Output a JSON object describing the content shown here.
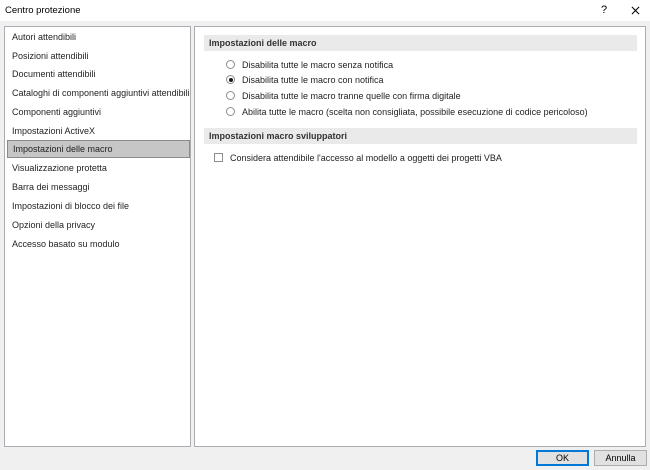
{
  "window": {
    "title": "Centro protezione",
    "help_label": "?"
  },
  "sidebar": {
    "items": [
      {
        "label": "Autori attendibili"
      },
      {
        "label": "Posizioni attendibili"
      },
      {
        "label": "Documenti attendibili"
      },
      {
        "label": "Cataloghi di componenti aggiuntivi attendibili"
      },
      {
        "label": "Componenti aggiuntivi"
      },
      {
        "label": "Impostazioni ActiveX"
      },
      {
        "label": "Impostazioni delle macro",
        "selected": true
      },
      {
        "label": "Visualizzazione protetta"
      },
      {
        "label": "Barra dei messaggi"
      },
      {
        "label": "Impostazioni di blocco dei file"
      },
      {
        "label": "Opzioni della privacy"
      },
      {
        "label": "Accesso basato su modulo"
      }
    ]
  },
  "macro_settings": {
    "header": "Impostazioni delle macro",
    "options": [
      {
        "label": "Disabilita tutte le macro senza notifica",
        "selected": false
      },
      {
        "label": "Disabilita tutte le macro con notifica",
        "selected": true
      },
      {
        "label": "Disabilita tutte le macro tranne quelle con firma digitale",
        "selected": false
      },
      {
        "label": "Abilita tutte le macro (scelta non consigliata, possibile esecuzione di codice pericoloso)",
        "selected": false
      }
    ]
  },
  "developer_settings": {
    "header": "Impostazioni macro sviluppatori",
    "checkbox_label": "Considera attendibile l'accesso al modello a oggetti dei progetti VBA",
    "checked": false
  },
  "footer": {
    "ok_label": "OK",
    "cancel_label": "Annulla"
  },
  "colors": {
    "selected_item_bg": "#c6c6c6",
    "section_header_bg": "#eaeaea",
    "default_button_border": "#0078d7"
  }
}
